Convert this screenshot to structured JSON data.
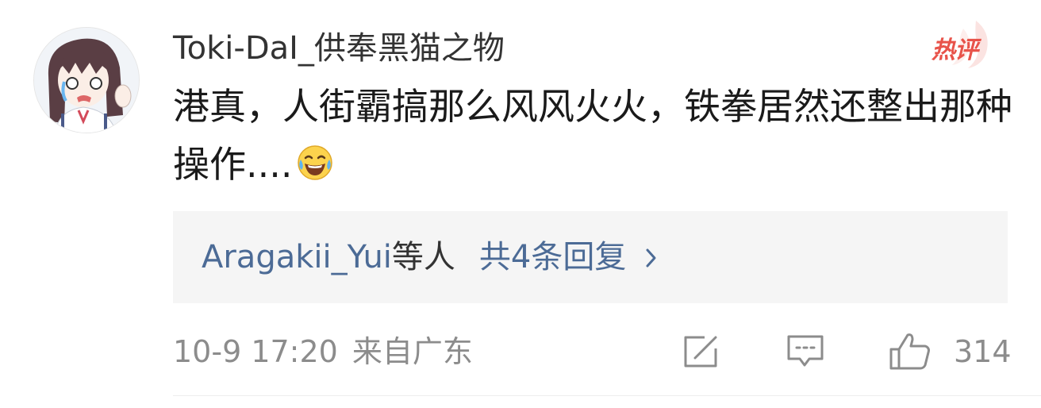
{
  "comment": {
    "username": "Toki-DaI_供奉黑猫之物",
    "badge": "热评",
    "text": "港真，人街霸搞那么风风火火，铁拳居然还整出那种操作....",
    "emoji_icon": "laughing-tears-emoji",
    "replies": {
      "user": "Aragakii_Yui",
      "others": "等人",
      "count_label": "共4条回复",
      "chevron_icon": "chevron-right-icon"
    },
    "meta": {
      "timestamp": "10-9 17:20",
      "location": "来自广东"
    },
    "actions": {
      "share_icon": "share-edit-icon",
      "comment_icon": "comment-icon",
      "like_icon": "thumbs-up-icon",
      "like_count": "314"
    },
    "colors": {
      "link_blue": "#4c6b96",
      "badge_red": "#e8534a",
      "meta_gray": "#8c8c8c",
      "reply_bg": "#f5f5f5"
    }
  }
}
